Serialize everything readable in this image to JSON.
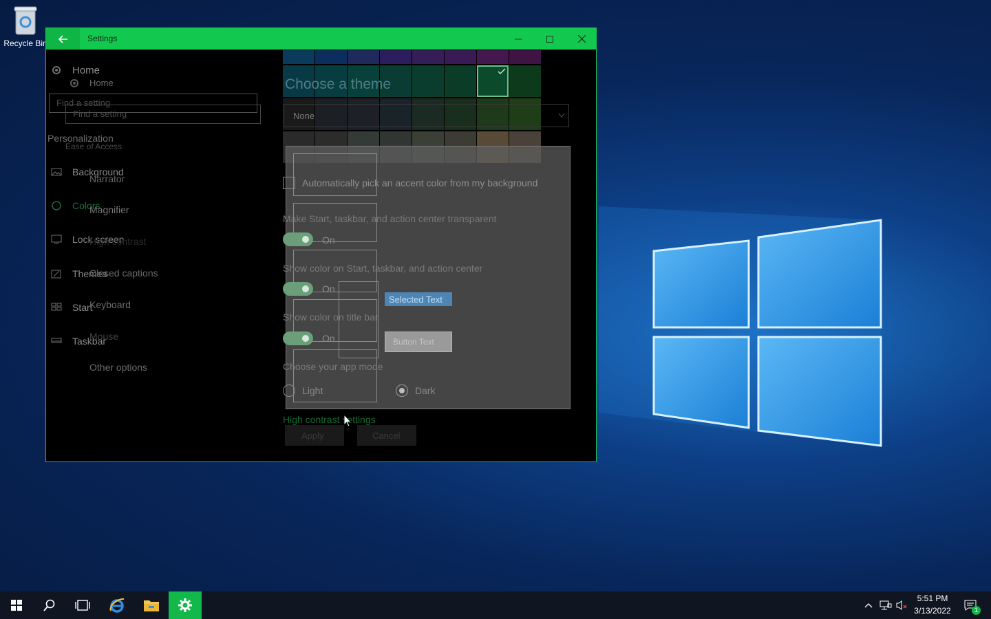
{
  "desktop": {
    "recycle_bin_label": "Recycle Bin"
  },
  "window": {
    "title": "Settings",
    "accent_color": "#12c84f"
  },
  "sidebar_ghost_1": {
    "home_label": "Home",
    "search_placeholder": "Find a setting",
    "section_title": "Personalization",
    "items": [
      "Background",
      "Colors",
      "Lock screen",
      "Themes",
      "Start",
      "Taskbar"
    ]
  },
  "sidebar_ghost_2": {
    "home_label": "Home",
    "search_placeholder": "Find a setting",
    "section_title": "Ease of Access",
    "items": [
      "Narrator",
      "Magnifier",
      "High contrast",
      "Closed captions",
      "Keyboard",
      "Mouse",
      "Other options"
    ]
  },
  "content": {
    "theme_heading": "Choose a theme",
    "theme_dropdown_value": "None",
    "auto_accent_label": "Automatically pick an accent color from my background",
    "transparent_label": "Make Start, taskbar, and action center transparent",
    "transparent_state": "On",
    "show_color_start_label": "Show color on Start, taskbar, and action center",
    "show_color_start_state": "On",
    "show_color_title_label": "Show color on title bar",
    "show_color_title_state": "On",
    "app_mode_label": "Choose your app mode",
    "app_mode_light": "Light",
    "app_mode_dark": "Dark",
    "high_contrast_link": "High contrast settings",
    "apply_label": "Apply",
    "cancel_label": "Cancel",
    "selected_text_sample": "Selected Text",
    "button_text_sample": "Button Text"
  },
  "taskbar": {
    "time": "5:51 PM",
    "date": "3/13/2022",
    "notification_count": "1"
  }
}
